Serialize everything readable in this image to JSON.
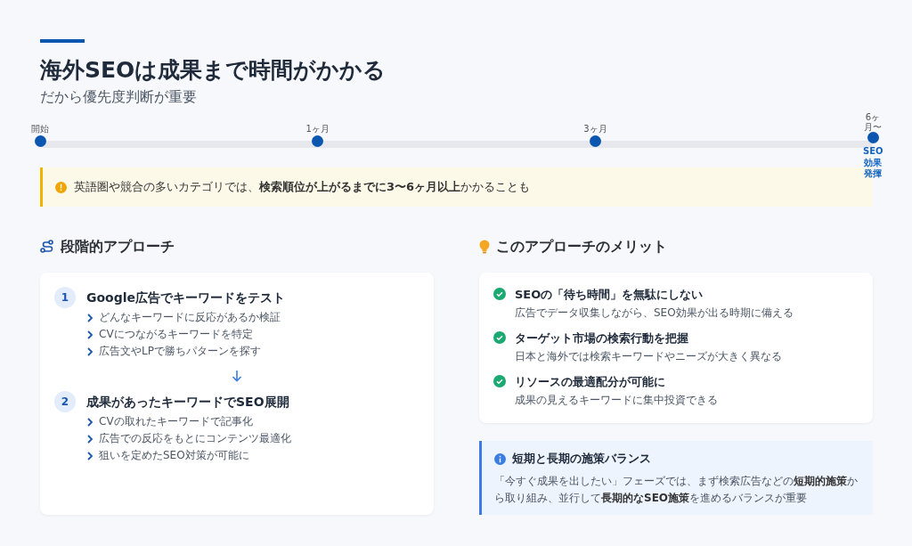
{
  "header": {
    "title": "海外SEOは成果まで時間がかかる",
    "subtitle": "だから優先度判断が重要"
  },
  "timeline": [
    {
      "label": "開始"
    },
    {
      "label": "1ヶ月"
    },
    {
      "label": "3ヶ月"
    },
    {
      "label": "6ヶ月〜",
      "sublabel": "SEO効果発揮"
    }
  ],
  "alert": {
    "text": "英語圏や競合の多いカテゴリでは、**検索順位が上がるまでに3〜6ヶ月以上**かかることも"
  },
  "approach": {
    "heading": "段階的アプローチ",
    "steps": [
      {
        "number": "1",
        "title": "Google広告でキーワードをテスト",
        "points": [
          "どんなキーワードに反応があるか検証",
          "CVにつながるキーワードを特定",
          "広告文やLPで勝ちパターンを探す"
        ]
      },
      {
        "number": "2",
        "title": "成果があったキーワードでSEO展開",
        "points": [
          "CVの取れたキーワードで記事化",
          "広告での反応をもとにコンテンツ最適化",
          "狙いを定めたSEO対策が可能に"
        ]
      }
    ]
  },
  "merits": {
    "heading": "このアプローチのメリット",
    "items": [
      {
        "title": "SEOの「待ち時間」を無駄にしない",
        "text": "広告でデータ収集しながら、SEO効果が出る時期に備える"
      },
      {
        "title": "ターゲット市場の検索行動を把握",
        "text": "日本と海外では検索キーワードやニーズが大きく異なる"
      },
      {
        "title": "リソースの最適配分が可能に",
        "text": "成果の見えるキーワードに集中投資できる"
      }
    ]
  },
  "note": {
    "title": "短期と長期の施策バランス",
    "text": "「今すぐ成果を出したい」フェーズでは、まず検索広告などの**短期的施策**から取り組み、並行して**長期的なSEO施策**を進めるバランスが重要"
  }
}
